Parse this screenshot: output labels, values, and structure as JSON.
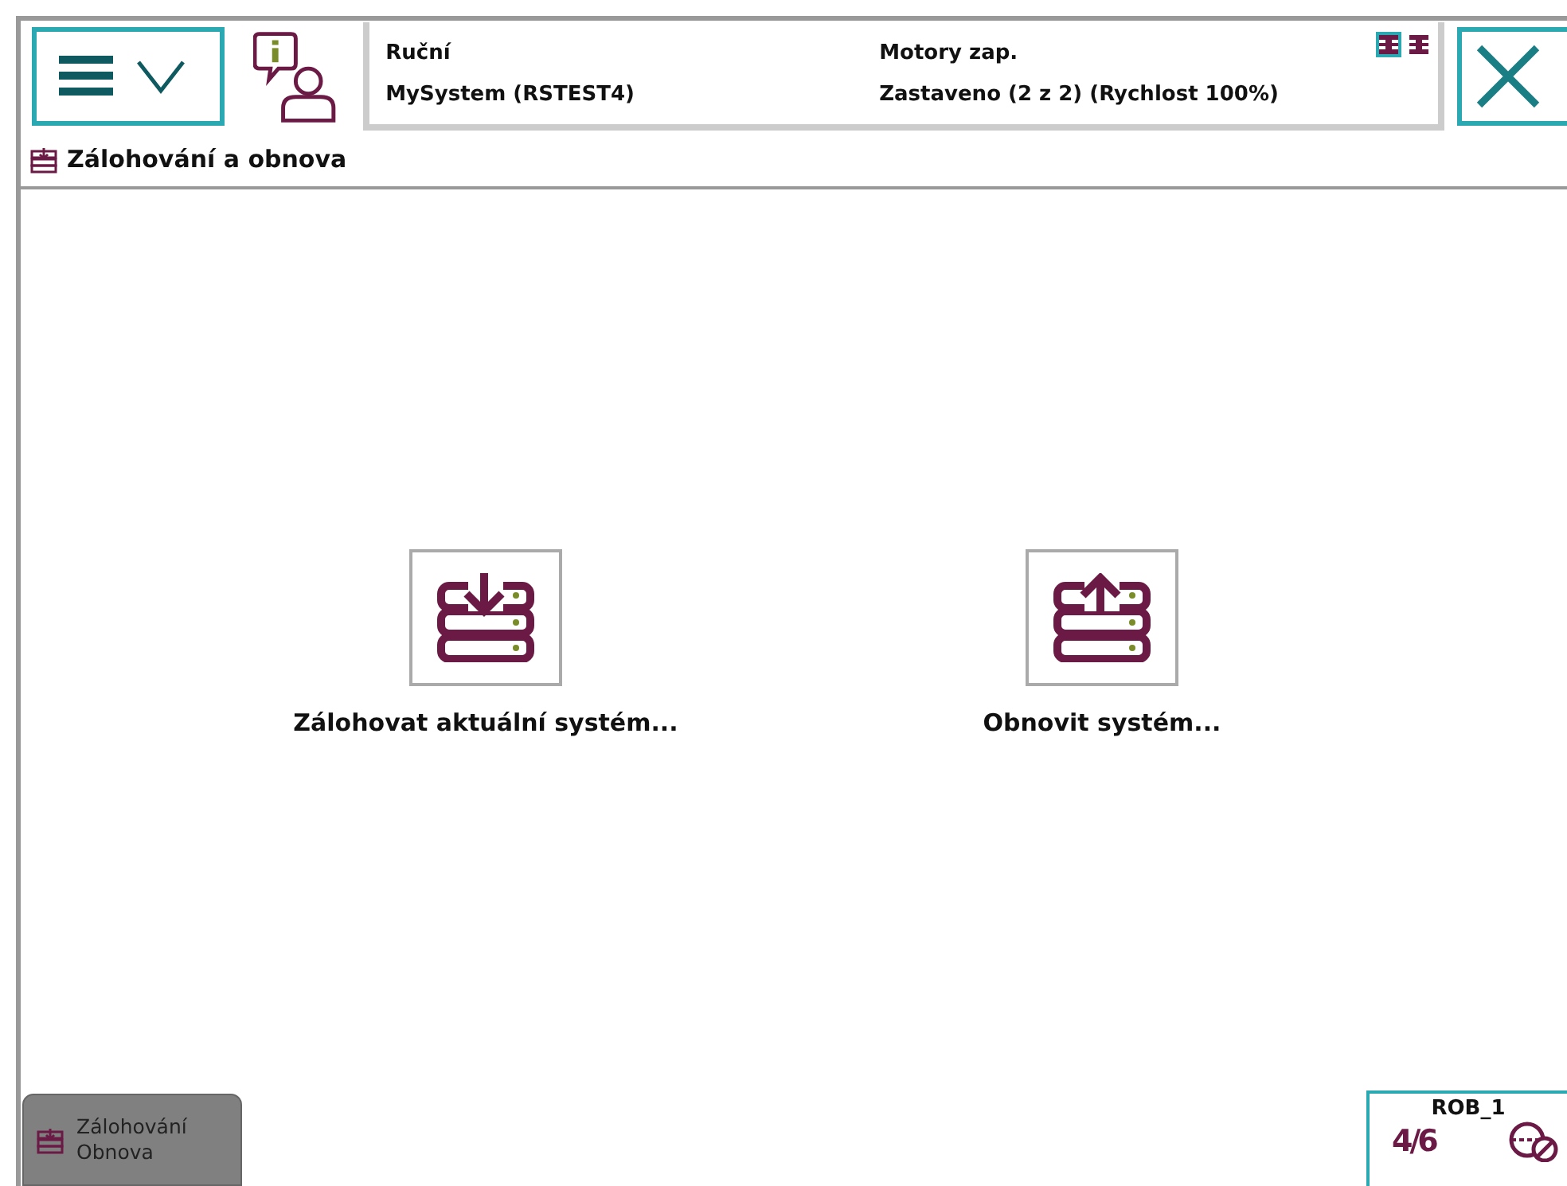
{
  "header": {
    "mode": "Ruční",
    "system": "MySystem (RSTEST4)",
    "motors": "Motory zap.",
    "state": "Zastaveno (2 z 2) (Rychlost 100%)",
    "units": [
      {
        "selected": true
      },
      {
        "selected": false
      }
    ]
  },
  "title": "Zálohování a obnova",
  "actions": [
    {
      "kind": "backup",
      "label": "Zálohovat aktuální systém..."
    },
    {
      "kind": "restore",
      "label": "Obnovit systém..."
    }
  ],
  "taskbar": [
    {
      "lines": [
        "Zálohování",
        "Obnova"
      ],
      "selected": true
    }
  ],
  "quickset": {
    "unit": "ROB_1",
    "axes": "4/6"
  }
}
